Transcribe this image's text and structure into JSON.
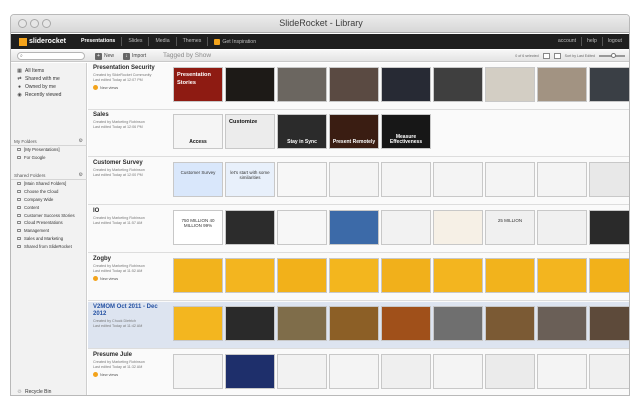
{
  "window": {
    "title": "SlideRocket - Library"
  },
  "app": {
    "logo": "sliderocket",
    "nav": [
      "Presentations",
      "Slides",
      "Media",
      "Themes"
    ],
    "inspiration": "Get Inspiration",
    "right_nav": [
      "account",
      "help",
      "logout"
    ]
  },
  "toolbar": {
    "new_label": "New",
    "import_label": "Import",
    "tagged": "Tagged by Show",
    "selection": "0 of 6 selected",
    "sort": "Sort by Last Edited"
  },
  "sidebar": {
    "items": [
      "All Items",
      "Shared with me",
      "Owned by me",
      "Recently viewed"
    ],
    "my_folders_title": "My Folders",
    "my_folders": [
      "[My Presentations]",
      "For Google"
    ],
    "shared_folders_title": "Shared Folders",
    "shared_folders": [
      "[Main Shared Folders]",
      "Choose the Cloud",
      "Company Wide",
      "Content",
      "Customer Success Stories",
      "Cloud Presentations",
      "Management",
      "Sales and Marketing",
      "Shared from SlideRocket"
    ],
    "recycle": "Recycle Bin"
  },
  "rows": [
    {
      "name": "Presentation Security",
      "created": "Created by SlideRocket Community",
      "edited": "Last edited Today at 12:07 PM",
      "badge": "New views",
      "thumbs": [
        {
          "bg": "#8e1b12",
          "big": "Presentation Stories"
        },
        {
          "bg": "#1d1a17"
        },
        {
          "bg": "#6b6660"
        },
        {
          "bg": "#5a4a42"
        },
        {
          "bg": "#272a34"
        },
        {
          "bg": "#3f3f3f"
        },
        {
          "bg": "#d3cec4"
        },
        {
          "bg": "#a29382"
        },
        {
          "bg": "#3a3f45"
        }
      ]
    },
    {
      "name": "Sales",
      "created": "Created by Marketing Robinson",
      "edited": "Last edited Today at 12:06 PM",
      "badge": "",
      "thumbs": [
        {
          "bg": "#f5f5f5",
          "label": "Access",
          "dark": true
        },
        {
          "bg": "#ececec",
          "big": "Customize",
          "dark": true
        },
        {
          "bg": "#2b2b2b",
          "label": "Stay in Sync"
        },
        {
          "bg": "#3a1d12",
          "label": "Present Remotely"
        },
        {
          "bg": "#171717",
          "label": "Measure Effectiveness"
        }
      ]
    },
    {
      "name": "Customer Survey",
      "created": "Created by Marketing Robinson",
      "edited": "Last edited Today at 12:00 PM",
      "badge": "",
      "thumbs": [
        {
          "bg": "#d9e7fb",
          "text": "Customer Survey"
        },
        {
          "bg": "#e8f0fb",
          "text": "let's start with some similarities"
        },
        {
          "bg": "#f7f7f7"
        },
        {
          "bg": "#f4f4f4"
        },
        {
          "bg": "#f4f4f4"
        },
        {
          "bg": "#f4f4f4"
        },
        {
          "bg": "#f4f4f4"
        },
        {
          "bg": "#f4f4f4"
        },
        {
          "bg": "#e8e8e8"
        }
      ]
    },
    {
      "name": "IO",
      "created": "Created by Marketing Robinson",
      "edited": "Last edited Today at 11:57 AM",
      "badge": "",
      "thumbs": [
        {
          "bg": "#ffffff",
          "text": "750 MILLION 40 MILLION 99%"
        },
        {
          "bg": "#2c2c2c"
        },
        {
          "bg": "#f7f7f7"
        },
        {
          "bg": "#3c6aa8"
        },
        {
          "bg": "#f2f2f2"
        },
        {
          "bg": "#f6f0e6"
        },
        {
          "bg": "#f0f0f0",
          "text": "25 MILLION"
        },
        {
          "bg": "#f0f0f0"
        },
        {
          "bg": "#2a2a2a"
        }
      ]
    },
    {
      "name": "Zogby",
      "created": "Created by Marketing Robinson",
      "edited": "Last edited Today at 11:52 AM",
      "badge": "New views",
      "thumbs": [
        {
          "bg": "#f2b31c"
        },
        {
          "bg": "#f3b51f"
        },
        {
          "bg": "#f2b11a"
        },
        {
          "bg": "#f3b61e"
        },
        {
          "bg": "#f1b01b"
        },
        {
          "bg": "#f3b51f"
        },
        {
          "bg": "#f2b31c"
        },
        {
          "bg": "#f3b51f"
        },
        {
          "bg": "#f2b11a"
        }
      ]
    },
    {
      "name": "V2MOM Oct 2011 - Dec 2012",
      "created": "Created by Chuck Dietrich",
      "edited": "Last edited Today at 11:42 AM",
      "badge": "",
      "selected": true,
      "thumbs": [
        {
          "bg": "#f3b61f"
        },
        {
          "bg": "#2a2a2a"
        },
        {
          "bg": "#7f6d4a"
        },
        {
          "bg": "#8c5f26"
        },
        {
          "bg": "#a0501a"
        },
        {
          "bg": "#6f6f6f"
        },
        {
          "bg": "#7b5a34"
        },
        {
          "bg": "#6a5f57"
        },
        {
          "bg": "#5d4a3a"
        }
      ]
    },
    {
      "name": "Presume Jule",
      "created": "Created by Marketing Robinson",
      "edited": "Last edited Today at 11:32 AM",
      "badge": "New views",
      "thumbs": [
        {
          "bg": "#f4f4f4"
        },
        {
          "bg": "#1e2f6b"
        },
        {
          "bg": "#f2f2f2"
        },
        {
          "bg": "#f4f4f4"
        },
        {
          "bg": "#efefef"
        },
        {
          "bg": "#f4f4f4"
        },
        {
          "bg": "#ebebeb"
        },
        {
          "bg": "#f4f4f4"
        },
        {
          "bg": "#f0f0f0"
        }
      ]
    }
  ]
}
